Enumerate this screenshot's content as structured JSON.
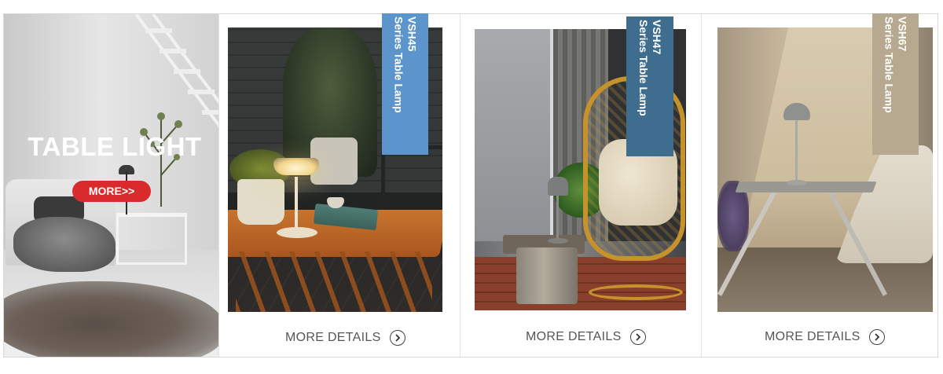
{
  "hero": {
    "title": "TABLE LIGHT",
    "button_label": "MORE>>",
    "button_color": "#d92b2b"
  },
  "products": [
    {
      "model": "VSH45",
      "series": "Series Table Lamp",
      "badge_color": "#5b95cc",
      "details_label": "MORE DETAILS",
      "details_icon": "chevron-right-circle-icon"
    },
    {
      "model": "VSH47",
      "series": "Series Table Lamp",
      "badge_color": "#3f6d8f",
      "details_label": "MORE DETAILS",
      "details_icon": "chevron-right-circle-icon"
    },
    {
      "model": "VSH67",
      "series": "Series Table Lamp",
      "badge_color": "#b7a98f",
      "details_label": "MORE DETAILS",
      "details_icon": "chevron-right-circle-icon"
    }
  ]
}
